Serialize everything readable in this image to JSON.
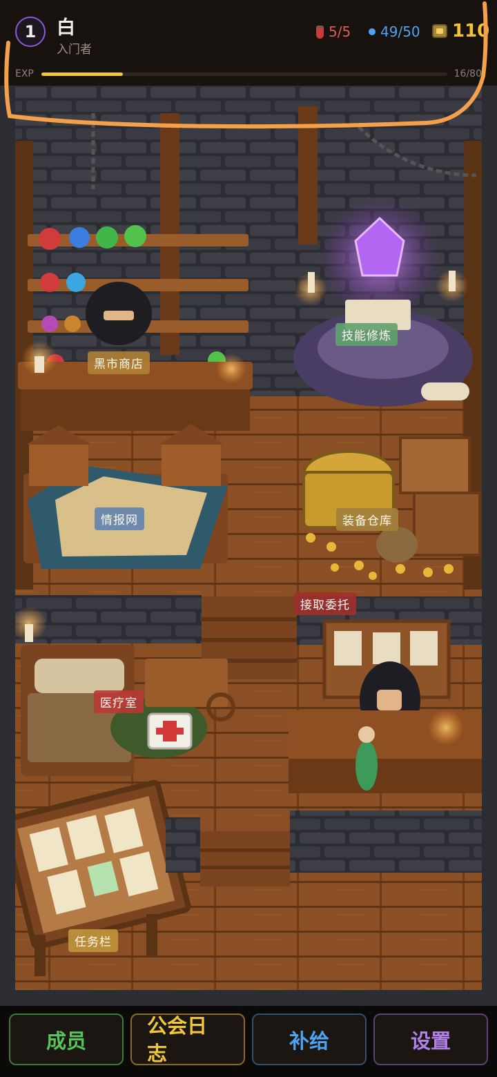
{
  "player": {
    "level": "1",
    "name": "白",
    "title": "入门者"
  },
  "stats": {
    "hp": "5/5",
    "mp": "49/50",
    "gold": "110",
    "hp_icon": "red-potion-icon",
    "mp_icon": "blue-orb-icon",
    "gold_icon": "gold-chest-icon"
  },
  "exp": {
    "label": "EXP",
    "value": "16/80",
    "progress": 0.2
  },
  "rooms": {
    "black_market": "黑市商店",
    "skill_training": "技能修炼",
    "intel_network": "情报网",
    "equipment_storage": "装备仓库",
    "accept_commission": "接取委托",
    "infirmary": "医疗室",
    "quest_board": "任务栏"
  },
  "nav": {
    "members": "成员",
    "guild_log": "公会日志",
    "supply": "补给",
    "settings": "设置"
  },
  "colors": {
    "accent_gold": "#f2c63b",
    "hp_red": "#e05a5a",
    "mp_blue": "#4fa3f2",
    "level_ring_purple": "#8b5ad6",
    "annotation_orange": "#f5a04a"
  }
}
